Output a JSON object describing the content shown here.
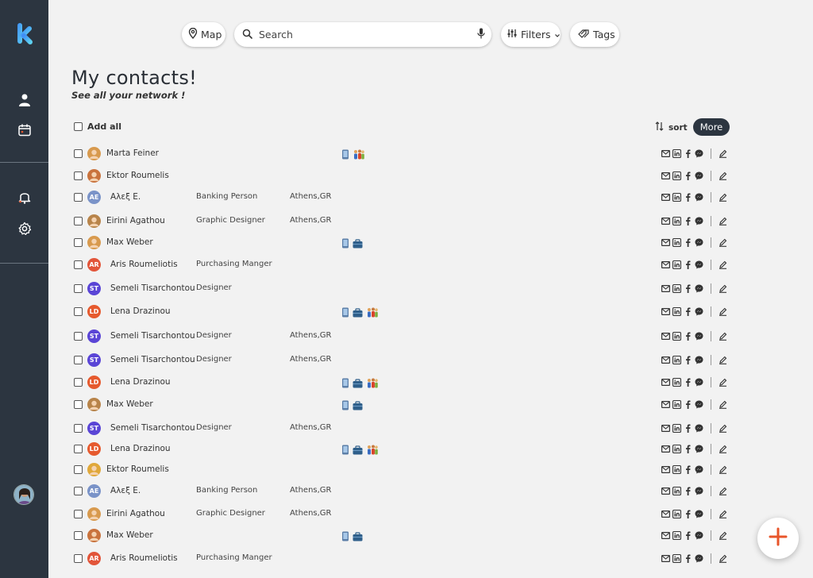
{
  "topbar": {
    "map_label": "Map",
    "search_placeholder": "Search",
    "filters_label": "Filters",
    "tags_label": "Tags"
  },
  "header": {
    "title": "My contacts!",
    "subtitle": "See all your network !"
  },
  "list_controls": {
    "add_all_label": "Add all",
    "sort_label": "sort",
    "more_label": "More"
  },
  "colors": {
    "sidebar": "#2c3540",
    "accent_orange": "#e8552a",
    "logo_blue": "#4aa3f0"
  },
  "contacts": [
    {
      "initials": "",
      "name": "Marta Feiner",
      "role": "",
      "location": "",
      "tags": [
        "phone",
        "people"
      ]
    },
    {
      "initials": "",
      "name": "Ektor Roumelis",
      "role": "",
      "location": "",
      "tags": []
    },
    {
      "initials": "AE",
      "name": "Αλεξ Ε.",
      "role": "Banking Person",
      "location": "Athens,GR",
      "tags": []
    },
    {
      "initials": "",
      "name": "Eirini Agathou",
      "role": "Graphic Designer",
      "location": "Athens,GR",
      "tags": []
    },
    {
      "initials": "",
      "name": "Max Weber",
      "role": "",
      "location": "",
      "tags": [
        "phone",
        "briefcase"
      ]
    },
    {
      "initials": "AR",
      "name": "Aris Roumeliotis",
      "role": "Purchasing Manger",
      "location": "",
      "tags": []
    },
    {
      "initials": "ST",
      "name": "Semeli Tisarchontou",
      "role": "Designer",
      "location": "",
      "tags": []
    },
    {
      "initials": "LD",
      "name": "Lena Drazinou",
      "role": "",
      "location": "",
      "tags": [
        "phone",
        "briefcase",
        "people"
      ]
    },
    {
      "initials": "ST",
      "name": "Semeli Tisarchontou",
      "role": "Designer",
      "location": "Athens,GR",
      "tags": []
    },
    {
      "initials": "ST",
      "name": "Semeli Tisarchontou",
      "role": "Designer",
      "location": "Athens,GR",
      "tags": []
    },
    {
      "initials": "LD",
      "name": "Lena Drazinou",
      "role": "",
      "location": "",
      "tags": [
        "phone",
        "briefcase",
        "people"
      ]
    },
    {
      "initials": "",
      "name": "Max Weber",
      "role": "",
      "location": "",
      "tags": [
        "phone",
        "briefcase"
      ]
    },
    {
      "initials": "ST",
      "name": "Semeli Tisarchontou",
      "role": "Designer",
      "location": "Athens,GR",
      "tags": []
    },
    {
      "initials": "LD",
      "name": "Lena Drazinou",
      "role": "",
      "location": "",
      "tags": [
        "phone",
        "briefcase",
        "people"
      ]
    },
    {
      "initials": "",
      "name": "Ektor Roumelis",
      "role": "",
      "location": "",
      "tags": []
    },
    {
      "initials": "AE",
      "name": "Αλεξ Ε.",
      "role": "Banking Person",
      "location": "Athens,GR",
      "tags": []
    },
    {
      "initials": "",
      "name": "Eirini Agathou",
      "role": "Graphic Designer",
      "location": "Athens,GR",
      "tags": []
    },
    {
      "initials": "",
      "name": "Max Weber",
      "role": "",
      "location": "",
      "tags": [
        "phone",
        "briefcase"
      ]
    },
    {
      "initials": "AR",
      "name": "Aris Roumeliotis",
      "role": "Purchasing Manger",
      "location": "",
      "tags": []
    }
  ]
}
